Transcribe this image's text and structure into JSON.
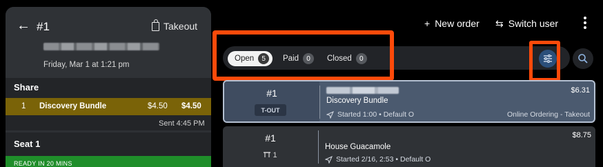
{
  "left_panel": {
    "back_glyph": "←",
    "order_number": "#1",
    "service_type": "Takeout",
    "date": "Friday, Mar 1 at 1:21 pm",
    "share": {
      "title": "Share",
      "item": {
        "qty": "1",
        "name": "Discovery Bundle",
        "price": "$4.50",
        "total": "$4.50"
      },
      "sent": "Sent 4:45 PM"
    },
    "seat": {
      "title": "Seat 1",
      "status": "READY IN 20 MINS"
    }
  },
  "top_bar": {
    "new_order": "New order",
    "new_order_glyph": "+",
    "switch_user": "Switch user",
    "switch_user_glyph": "⇆"
  },
  "filters": {
    "open": {
      "label": "Open",
      "count": "5"
    },
    "paid": {
      "label": "Paid",
      "count": "0"
    },
    "closed": {
      "label": "Closed",
      "count": "0"
    }
  },
  "orders": [
    {
      "number": "#1",
      "tag": "T-OUT",
      "title": "Discovery Bundle",
      "meta": "Started 1:00 • Default O",
      "price": "$6.31",
      "source": "Online Ordering - Takeout"
    },
    {
      "number": "#1",
      "seat_count": "1",
      "title": "House Guacamole",
      "meta": "Started 2/16, 2:53 • Default O",
      "price": "$8.75"
    }
  ],
  "colors": {
    "highlight": "#ff4a0a",
    "ready_green": "#1f8e2a",
    "selected_item": "#7a6308",
    "selected_order": "#4b5a6f"
  },
  "icons": [
    "back-arrow-icon",
    "takeout-bag-icon",
    "plus-icon",
    "switch-user-icon",
    "more-vert-icon",
    "filter-sliders-icon",
    "search-icon",
    "send-icon",
    "table-icon"
  ]
}
